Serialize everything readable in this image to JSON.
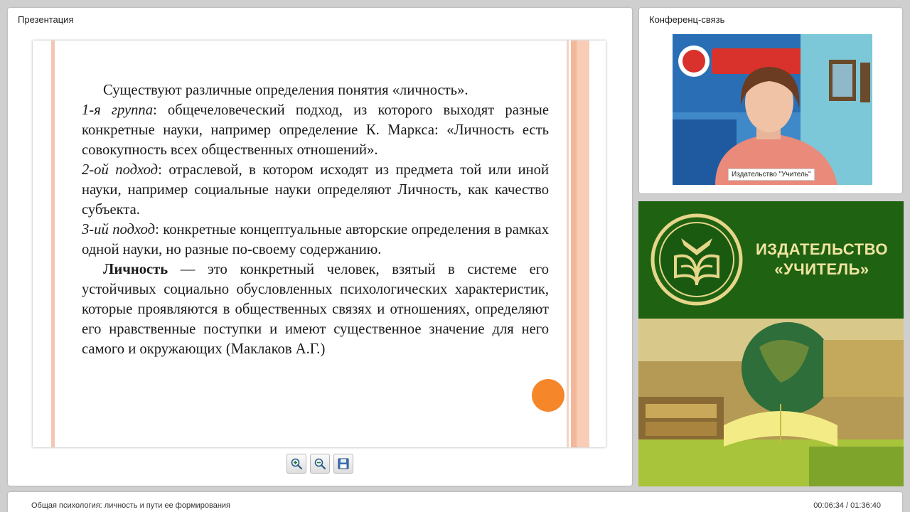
{
  "presentation": {
    "title": "Презентация",
    "slide": {
      "p1": "Существуют различные определения понятия «личность».",
      "p2_label": "1-я группа",
      "p2_text": ": общечеловеческий подход, из которого выходят разные конкретные науки, например определение К. Маркса: «Личность есть совокупность всех общественных отношений».",
      "p3_label": "2-ой подход",
      "p3_text": ": отраслевой, в котором исходят из предмета той или иной науки, например социальные науки определяют Личность, как качество субъекта.",
      "p4_label": "3-ий подход",
      "p4_text": ": конкретные концептуальные авторские определения в рамках одной науки, но разные по-своему содержанию.",
      "p5_term": "Личность",
      "p5_text": " — это конкретный человек, взятый в системе его устойчивых социально обусловленных психологических характеристик, которые проявляются в общественных связях и отношениях, определяют его нравственные поступки и имеют существенное значение для него самого и окружающих (Маклаков А.Г.)"
    },
    "toolbar": {
      "zoom_in_icon": "zoom-in-icon",
      "zoom_out_icon": "zoom-out-icon",
      "save_icon": "save-icon"
    }
  },
  "conference": {
    "title": "Конференц-связь",
    "video_caption": "Издательство \"Учитель\""
  },
  "banner": {
    "line1": "ИЗДАТЕЛЬСТВО",
    "line2": "«УЧИТЕЛЬ»"
  },
  "bottom": {
    "course_title": "Общая психология: личность и пути ее формирования",
    "time": "00:06:34 / 01:36:40"
  },
  "colors": {
    "accent_orange": "#f5862a",
    "banner_green": "#1f6212",
    "banner_gold": "#f1e4a0",
    "video_blue": "#3f89c8"
  }
}
